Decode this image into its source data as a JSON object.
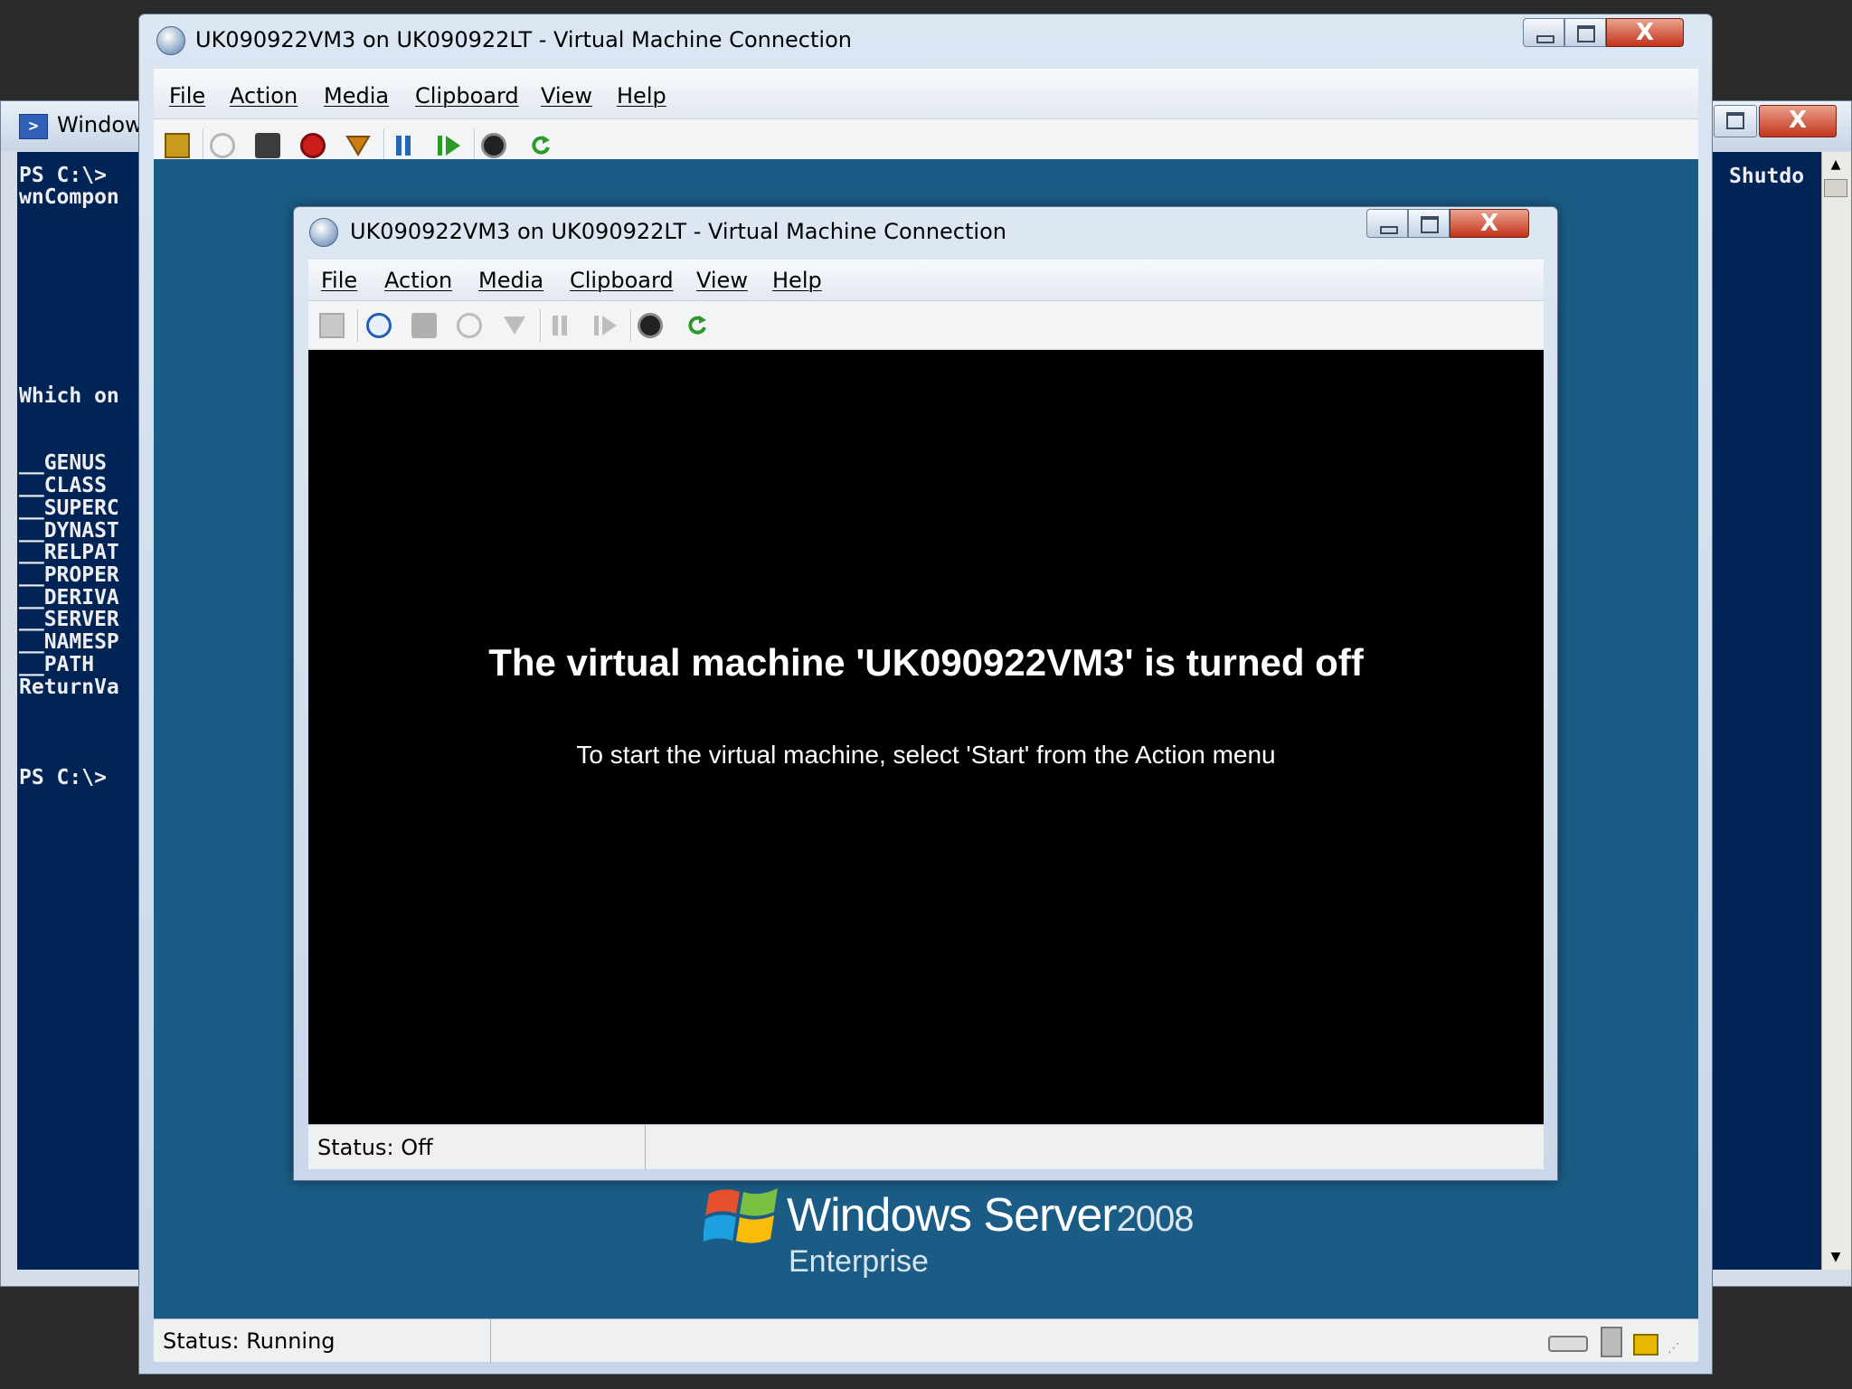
{
  "powershell": {
    "title": "Window",
    "lines": [
      "PS C:\\>",
      "wnCompon",
      "Which on",
      "__GENUS",
      "__CLASS",
      "__SUPERC",
      "__DYNAST",
      "__RELPAT",
      "__PROPER",
      "__DERIVA",
      "__SERVER",
      "__NAMESP",
      "__PATH",
      "ReturnVa",
      "PS C:\\>"
    ],
    "right_text": "Shutdo",
    "close_glyph": "X"
  },
  "outer_window": {
    "title": "UK090922VM3 on UK090922LT - Virtual Machine Connection",
    "menu": [
      "File",
      "Action",
      "Media",
      "Clipboard",
      "View",
      "Help"
    ],
    "status": "Status: Running",
    "close_glyph": "X"
  },
  "inner_window": {
    "title": "UK090922VM3 on UK090922LT - Virtual Machine Connection",
    "menu": [
      "File",
      "Action",
      "Media",
      "Clipboard",
      "View",
      "Help"
    ],
    "heading": "The virtual machine 'UK090922VM3' is turned off",
    "subtext": "To start the virtual machine, select 'Start' from the Action menu",
    "status": "Status: Off",
    "close_glyph": "X"
  },
  "branding": {
    "name": "Windows Server",
    "year": "2008",
    "edition": "Enterprise"
  },
  "colors": {
    "desktop_blue": "#1b5c86",
    "console_blue": "#012456",
    "vm_screen": "#000000"
  },
  "toolbar_icons_outer": [
    "ctrl-alt-del-icon",
    "start-icon",
    "turn-off-icon",
    "shutdown-icon",
    "save-icon",
    "pause-icon",
    "resume-icon",
    "snapshot-icon",
    "revert-icon"
  ],
  "toolbar_icons_inner": [
    "ctrl-alt-del-icon",
    "start-icon",
    "turn-off-icon",
    "shutdown-icon",
    "save-icon",
    "pause-icon",
    "resume-icon",
    "snapshot-icon",
    "revert-icon"
  ]
}
